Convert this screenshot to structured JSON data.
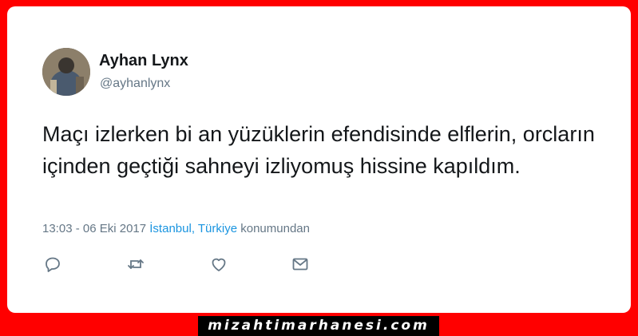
{
  "tweet": {
    "display_name": "Ayhan Lynx",
    "handle": "@ayhanlynx",
    "text": "Maçı izlerken bi an yüzüklerin efendisinde elflerin, orcların içinden geçtiği sahneyi izliyomuş hissine kapıldım.",
    "timestamp": "13:03 - 06 Eki 2017",
    "location_city": "İstanbul",
    "location_separator": ", ",
    "location_country": "Türkiye",
    "location_suffix": "konumundan",
    "avatar_icon": "profile-photo"
  },
  "actions": [
    {
      "name": "reply",
      "icon": "speech-bubble-icon"
    },
    {
      "name": "retweet",
      "icon": "retweet-arrows-icon"
    },
    {
      "name": "like",
      "icon": "heart-icon"
    },
    {
      "name": "message",
      "icon": "envelope-icon"
    }
  ],
  "watermark": {
    "text": "mizahtimarhanesi.com"
  },
  "colors": {
    "frame": "#ff0000",
    "card": "#ffffff",
    "link": "#1b95e0",
    "secondary_text": "#657786",
    "primary_text": "#14171a"
  }
}
